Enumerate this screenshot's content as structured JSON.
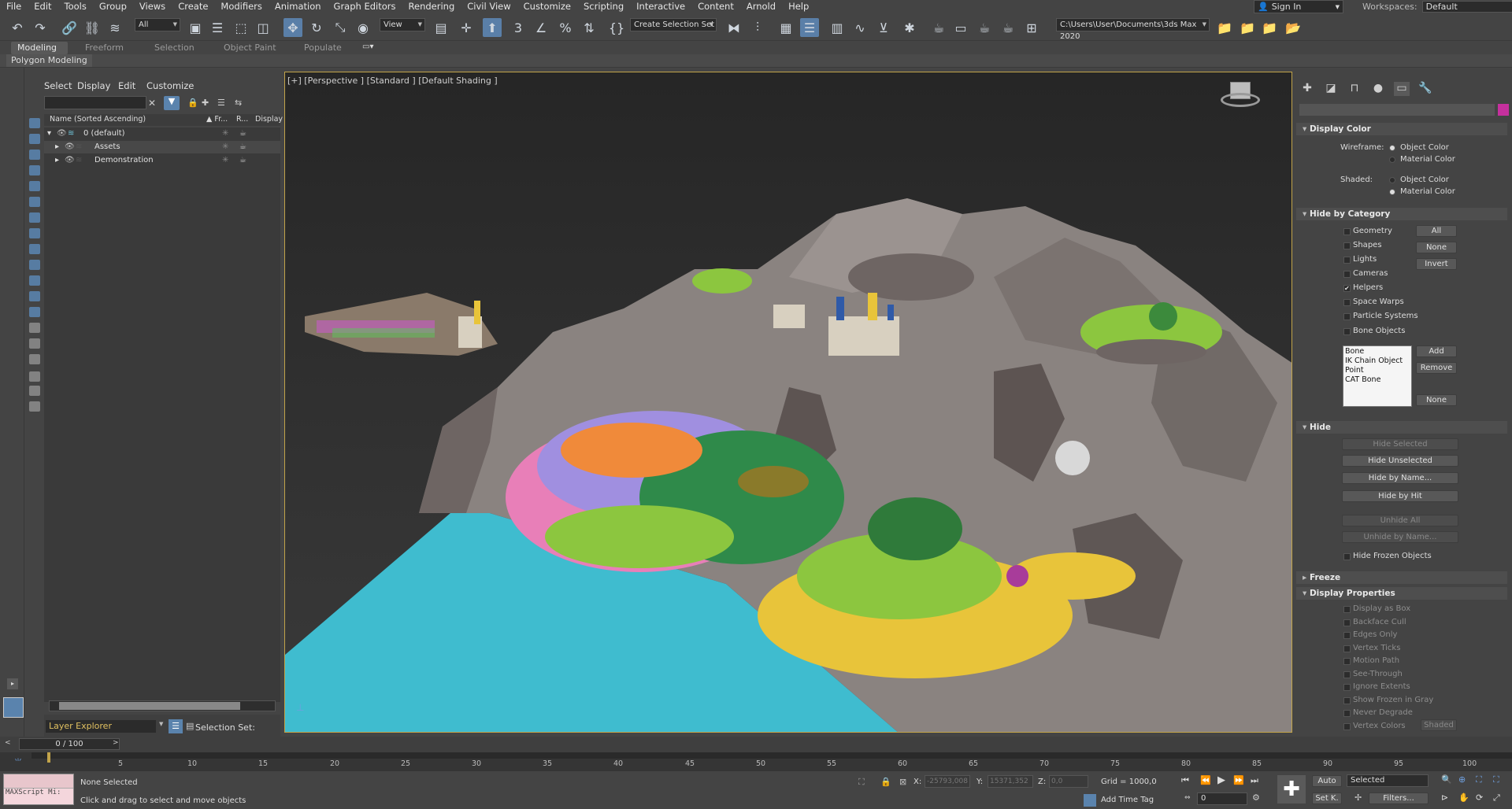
{
  "menubar": {
    "items": [
      "File",
      "Edit",
      "Tools",
      "Group",
      "Views",
      "Create",
      "Modifiers",
      "Animation",
      "Graph Editors",
      "Rendering",
      "Civil View",
      "Customize",
      "Scripting",
      "Interactive",
      "Content",
      "Arnold",
      "Help"
    ],
    "sign_in": "Sign In",
    "workspaces_label": "Workspaces:",
    "workspace_value": "Default"
  },
  "toolbar": {
    "filter_value": "All",
    "refcoord_value": "View",
    "selection_set_value": "Create Selection Set",
    "project_path": "C:\\Users\\User\\Documents\\3ds Max 2020"
  },
  "ribbon": {
    "tabs": [
      "Modeling",
      "Freeform",
      "Selection",
      "Object Paint",
      "Populate"
    ],
    "panel_label": "Polygon Modeling"
  },
  "explorer": {
    "menu": [
      "Select",
      "Display",
      "Edit",
      "Customize"
    ],
    "columns": [
      "Name (Sorted Ascending)",
      "▲ Fr...",
      "R...",
      "Display"
    ],
    "rows": [
      "0 (default)",
      "Assets",
      "Demonstration"
    ],
    "explorer_type": "Layer Explorer",
    "selection_set_label": "Selection Set:"
  },
  "viewport": {
    "label": "[+] [Perspective ] [Standard ] [Default Shading ]"
  },
  "command_panel": {
    "display_color": {
      "title": "Display Color",
      "wireframe_label": "Wireframe:",
      "shaded_label": "Shaded:",
      "object_color": "Object Color",
      "material_color": "Material Color"
    },
    "hide_by_category": {
      "title": "Hide by Category",
      "categories": [
        "Geometry",
        "Shapes",
        "Lights",
        "Cameras",
        "Helpers",
        "Space Warps",
        "Particle Systems",
        "Bone Objects"
      ],
      "btn_all": "All",
      "btn_none": "None",
      "btn_invert": "Invert",
      "list": [
        "Bone",
        "IK Chain Object",
        "Point",
        "CAT Bone"
      ],
      "btn_add": "Add",
      "btn_remove": "Remove",
      "btn_none2": "None"
    },
    "hide": {
      "title": "Hide",
      "hide_selected": "Hide Selected",
      "hide_unselected": "Hide Unselected",
      "hide_by_name": "Hide by Name...",
      "hide_by_hit": "Hide by Hit",
      "unhide_all": "Unhide All",
      "unhide_by_name": "Unhide by Name...",
      "hide_frozen": "Hide Frozen Objects"
    },
    "freeze": {
      "title": "Freeze"
    },
    "display_properties": {
      "title": "Display Properties",
      "items": [
        "Display as Box",
        "Backface Cull",
        "Edges Only",
        "Vertex Ticks",
        "Motion Path",
        "See-Through",
        "Ignore Extents",
        "Show Frozen in Gray",
        "Never Degrade",
        "Vertex Colors"
      ],
      "shaded_btn": "Shaded"
    }
  },
  "timeline": {
    "frame_counter": "0 / 100",
    "ticks": [
      "5",
      "10",
      "15",
      "20",
      "25",
      "30",
      "35",
      "40",
      "45",
      "50",
      "55",
      "60",
      "65",
      "70",
      "75",
      "80",
      "85",
      "90",
      "95",
      "100"
    ]
  },
  "status": {
    "maxscript": "MAXScript Mi:",
    "none_selected": "None Selected",
    "prompt": "Click and drag to select and move objects",
    "x_label": "X:",
    "x_value": "-25793,008",
    "y_label": "Y:",
    "y_value": "15371,352",
    "z_label": "Z:",
    "z_value": "0,0",
    "grid": "Grid = 1000,0",
    "add_time_tag": "Add Time Tag",
    "auto": "Auto",
    "set_key": "Set K.",
    "selected": "Selected",
    "filters": "Filters...",
    "frame_value": "0"
  },
  "colors": {
    "accent": "#5a83ad",
    "viewport_border": "#c2a44a",
    "water": "#3fbccf",
    "rock": "#8a8380"
  }
}
